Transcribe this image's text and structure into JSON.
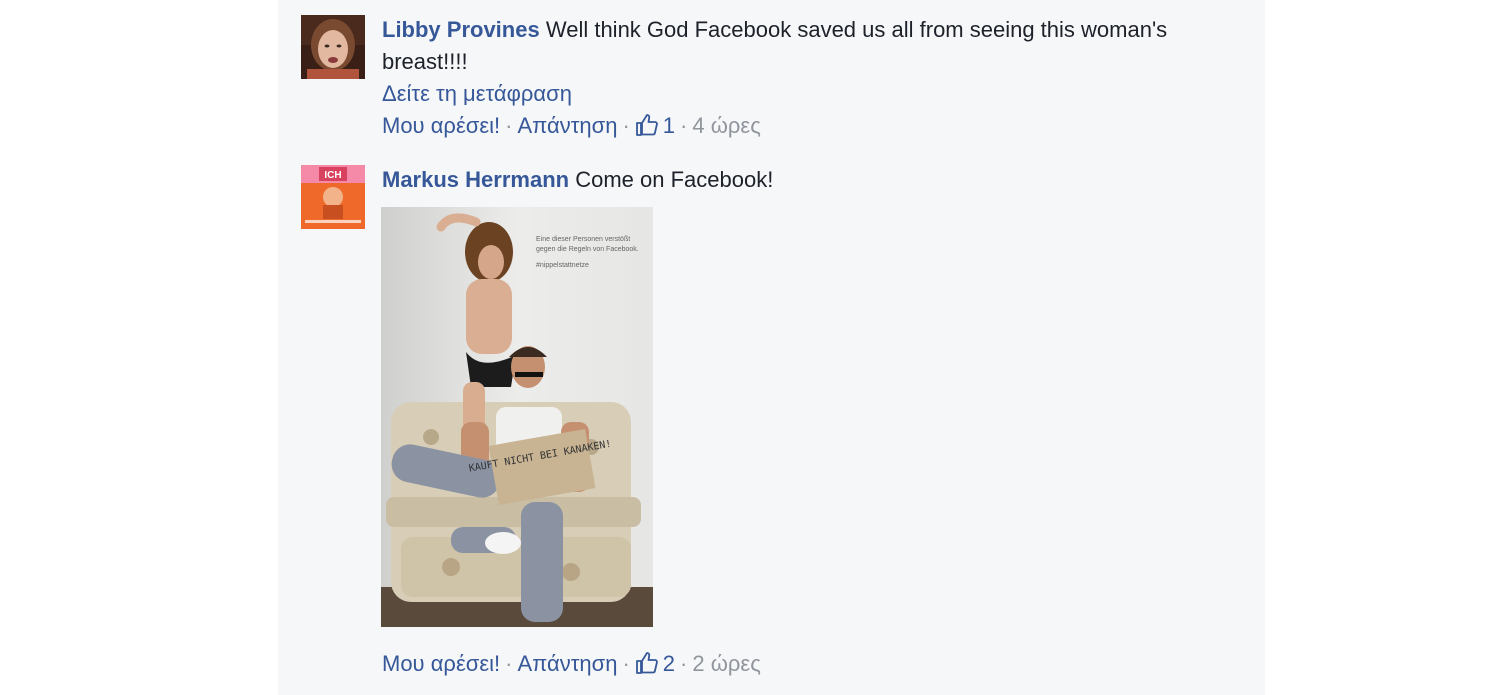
{
  "comments": [
    {
      "author": "Libby Provines",
      "text": "Well think God Facebook saved us all from seeing this woman's breast!!!!",
      "translate_link": "Δείτε τη μετάφραση",
      "like_label": "Μου αρέσει!",
      "reply_label": "Απάντηση",
      "like_count": "1",
      "time": "4 ώρες"
    },
    {
      "author": "Markus Herrmann",
      "text": "Come on Facebook!",
      "avatar_text": "ICH",
      "photo_caption": "Eine dieser Personen verstößt gegen die Regeln von Facebook.",
      "photo_hashtag": "#nippelstattnetze",
      "photo_sign": "KAUFT NICHT BEI KANAKEN!",
      "like_label": "Μου αρέσει!",
      "reply_label": "Απάντηση",
      "like_count": "2",
      "time": "2 ώρες"
    }
  ],
  "colors": {
    "link": "#365899",
    "meta": "#90949c",
    "text": "#1d2129",
    "panel_bg": "#f6f7f9"
  }
}
